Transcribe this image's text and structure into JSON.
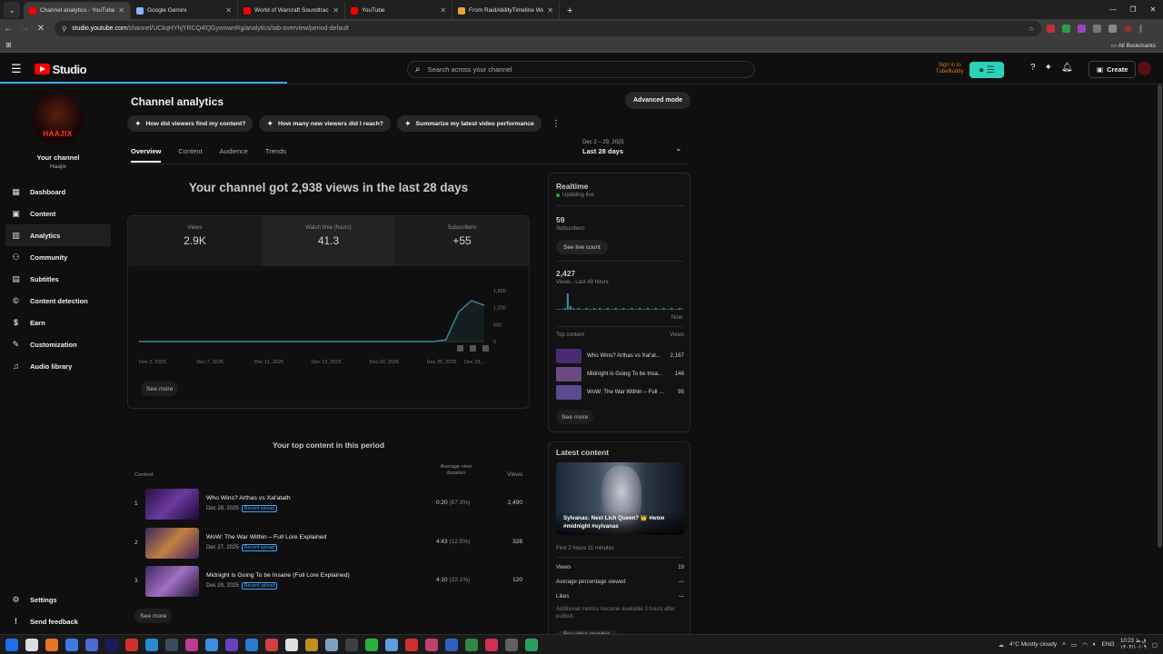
{
  "browser": {
    "tabs": [
      {
        "title": "Channel analytics - YouTube Studio",
        "color": "#ff0000",
        "active": true
      },
      {
        "title": "Google Gemini",
        "color": "#8ab4f8",
        "active": false
      },
      {
        "title": "World of Warcraft Soundtrack",
        "color": "#ff0000",
        "active": false
      },
      {
        "title": "YouTube",
        "color": "#ff0000",
        "active": false
      },
      {
        "title": "From RaidAbilityTimeline Weak",
        "color": "#e8a33d",
        "active": false
      }
    ],
    "url_host": "studio.youtube.com",
    "url_path": "/channel/UCkqHYhjYRCQ4lQGyxmwnRg/analytics/tab-overview/period-default",
    "all_bookmarks": "All Bookmarks"
  },
  "header": {
    "studio_label": "Studio",
    "search_placeholder": "Search across your channel",
    "tubebuddy_line1": "Sign in to",
    "tubebuddy_line2": "TubeBuddy",
    "create_label": "Create"
  },
  "sidebar": {
    "avatar_text": "HAAJIX",
    "channel_title": "Your channel",
    "channel_handle": "Haajix",
    "items": [
      {
        "label": "Dashboard",
        "icon": "dashboard-icon",
        "glyph": "▦"
      },
      {
        "label": "Content",
        "icon": "content-icon",
        "glyph": "▣"
      },
      {
        "label": "Analytics",
        "icon": "analytics-icon",
        "glyph": "▥"
      },
      {
        "label": "Community",
        "icon": "community-icon",
        "glyph": "⚇"
      },
      {
        "label": "Subtitles",
        "icon": "subtitles-icon",
        "glyph": "▤"
      },
      {
        "label": "Content detection",
        "icon": "copyright-icon",
        "glyph": "©"
      },
      {
        "label": "Earn",
        "icon": "earn-icon",
        "glyph": "$"
      },
      {
        "label": "Customization",
        "icon": "customization-icon",
        "glyph": "✎"
      },
      {
        "label": "Audio library",
        "icon": "audio-library-icon",
        "glyph": "♫"
      }
    ],
    "bottom": [
      {
        "label": "Settings",
        "icon": "settings-icon",
        "glyph": "⚙"
      },
      {
        "label": "Send feedback",
        "icon": "feedback-icon",
        "glyph": "!"
      }
    ]
  },
  "main": {
    "title": "Channel analytics",
    "advanced_mode": "Advanced mode",
    "chips": [
      "How did viewers find my content?",
      "How many new viewers did I reach?",
      "Summarize my latest video performance"
    ],
    "tabs": [
      "Overview",
      "Content",
      "Audience",
      "Trends"
    ],
    "date_range_sub": "Dec 2 – 29, 2025",
    "date_range_main": "Last 28 days",
    "headline": "Your channel got 2,938 views in the last 28 days",
    "metrics": [
      {
        "label": "Views",
        "value": "2.9K"
      },
      {
        "label": "Watch time (hours)",
        "value": "41.3"
      },
      {
        "label": "Subscribers",
        "value": "+55"
      }
    ],
    "see_more": "See more",
    "top_content_title": "Your top content in this period",
    "table_headers": {
      "content": "Content",
      "avd_line1": "Average view",
      "avd_line2": "duration",
      "views": "Views"
    },
    "rows": [
      {
        "num": "1",
        "title": "Who Wins? Arthas vs Xal'atath",
        "date": "Dec 28, 2025",
        "badge": "Recent upload",
        "avd": "0:20",
        "pct": "(87.3%)",
        "views": "2,490"
      },
      {
        "num": "2",
        "title": "WoW: The War Within – Full Lore Explained",
        "date": "Dec 27, 2025",
        "badge": "Recent upload",
        "avd": "4:43",
        "pct": "(12.5%)",
        "views": "328"
      },
      {
        "num": "3",
        "title": "Midnight is Going To be Insane (Full Lore Explained)",
        "date": "Dec 29, 2025",
        "badge": "Recent upload",
        "avd": "4:10",
        "pct": "(22.1%)",
        "views": "120"
      }
    ],
    "table_see_more": "See more"
  },
  "chart_data": {
    "type": "line",
    "x_ticks": [
      "Dec 2, 2025",
      "Dec 7, 2025",
      "Dec 11, 2025",
      "Dec 15, 2025",
      "Dec 20, 2025",
      "Dec 25, 2025",
      "Dec 29,..."
    ],
    "y_ticks": [
      "1,800",
      "1,200",
      "600",
      "0"
    ],
    "ylim": [
      0,
      1800
    ],
    "series": [
      {
        "values": [
          0,
          0,
          0,
          0,
          0,
          0,
          0,
          0,
          0,
          0,
          0,
          0,
          0,
          0,
          0,
          0,
          0,
          0,
          0,
          0,
          0,
          0,
          0,
          0,
          60,
          1050,
          1450,
          1280
        ]
      }
    ],
    "color": "#3a8a9a"
  },
  "realtime": {
    "title": "Realtime",
    "updating": "Updating live",
    "subs_value": "59",
    "subs_label": "Subscribers",
    "live_count_btn": "See live count",
    "views_value": "2,427",
    "views_label": "Views · Last 48 hours",
    "now_label": "Now",
    "top_content_label": "Top content",
    "views_col_label": "Views",
    "top": [
      {
        "title": "Who Wins? Arthas vs Xal'at...",
        "views": "2,167"
      },
      {
        "title": "Midnight is Going To be Insa...",
        "views": "146"
      },
      {
        "title": "WoW: The War Within – Full ...",
        "views": "95"
      }
    ],
    "see_more": "See more",
    "spark": [
      0,
      0,
      0,
      1,
      9,
      2,
      1,
      0,
      1,
      0,
      0,
      1,
      0,
      0,
      1,
      0,
      1,
      0,
      0,
      1,
      0,
      0,
      1,
      0,
      0,
      1,
      0,
      0,
      1,
      0,
      0,
      1,
      0,
      0,
      1,
      0,
      0,
      1,
      0,
      0,
      1,
      0,
      0,
      1,
      0,
      0,
      1,
      0
    ]
  },
  "latest": {
    "title": "Latest content",
    "caption": "Sylvanas: Next Lich Queen? 👑 #wow #midnight #sylvanas",
    "first_time": "First 2 hours 11 minutes",
    "stats": [
      {
        "label": "Views",
        "value": "19"
      },
      {
        "label": "Average percentage viewed",
        "value": "—"
      },
      {
        "label": "Likes",
        "value": "—"
      }
    ],
    "note": "Additional metrics become available 3 hours after publish.",
    "analytics_btn": "See video analytics"
  },
  "taskbar": {
    "weather": "4°C  Mostly cloudy",
    "lang": "ENG",
    "time": "10:23 ق.ظ",
    "date": "۱۴۰۴/۱۰/۰۹"
  }
}
